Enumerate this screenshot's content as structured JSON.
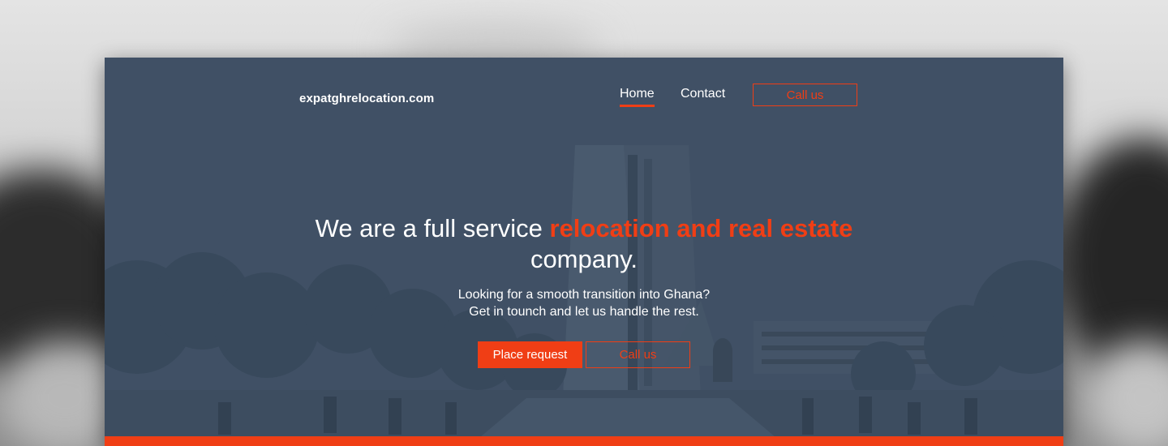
{
  "header": {
    "logo": "expatghrelocation.com",
    "nav": {
      "home": "Home",
      "contact": "Contact",
      "call": "Call us"
    }
  },
  "hero": {
    "headline_pre": "We are a full service ",
    "headline_accent": "relocation and real estate",
    "headline_post": "company.",
    "sub_line1": "Looking for a smooth transition into Ghana?",
    "sub_line2": "Get in tounch and let us handle the rest.",
    "primary_button": "Place request",
    "secondary_button": "Call us"
  },
  "colors": {
    "accent": "#f03e15",
    "overlay": "#3f5065",
    "text": "#ffffff"
  }
}
